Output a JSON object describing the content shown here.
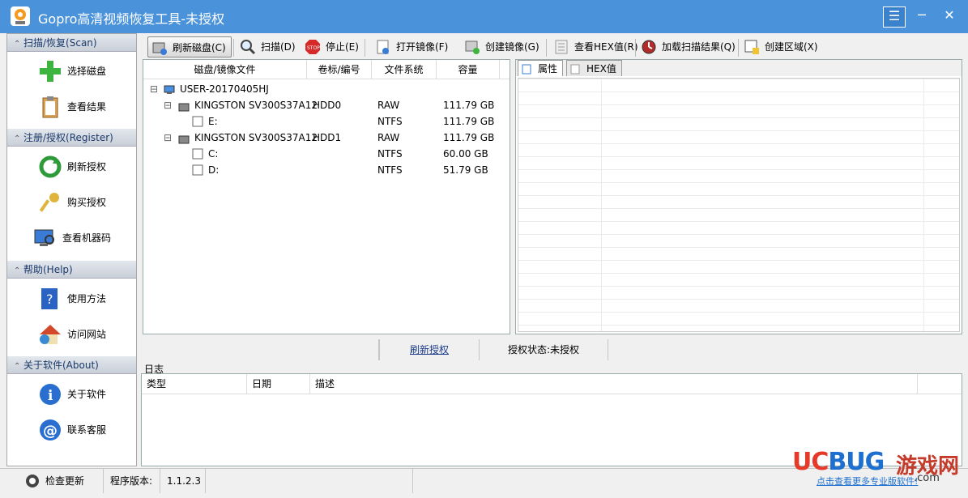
{
  "window": {
    "title": "Gopro高清视频恢复工具-未授权",
    "buttons": {
      "menu": "☰",
      "minimize": "─",
      "close": "✕"
    }
  },
  "sidebar": {
    "sections": [
      {
        "title": "扫描/恢复(Scan)",
        "items": [
          {
            "label": "选择磁盘",
            "icon": "add-plus-icon"
          },
          {
            "label": "查看结果",
            "icon": "clipboard-icon"
          }
        ]
      },
      {
        "title": "注册/授权(Register)",
        "items": [
          {
            "label": "刷新授权",
            "icon": "refresh-icon"
          },
          {
            "label": "购买授权",
            "icon": "key-icon"
          },
          {
            "label": "查看机器码",
            "icon": "computer-search-icon"
          }
        ]
      },
      {
        "title": "帮助(Help)",
        "items": [
          {
            "label": "使用方法",
            "icon": "help-book-icon"
          },
          {
            "label": "访问网站",
            "icon": "home-globe-icon"
          }
        ]
      },
      {
        "title": "关于软件(About)",
        "items": [
          {
            "label": "关于软件",
            "icon": "info-icon"
          },
          {
            "label": "联系客服",
            "icon": "at-mail-icon"
          }
        ]
      }
    ]
  },
  "toolbar": {
    "buttons": [
      {
        "label": "刷新磁盘(C)",
        "icon": "refresh-disk-icon"
      },
      {
        "label": "扫描(D)",
        "icon": "magnifier-icon"
      },
      {
        "label": "停止(E)",
        "icon": "stop-sign-icon"
      },
      {
        "label": "打开镜像(F)",
        "icon": "open-image-icon"
      },
      {
        "label": "创建镜像(G)",
        "icon": "create-image-icon"
      },
      {
        "label": "查看HEX值(R)",
        "icon": "hex-icon"
      },
      {
        "label": "加载扫描结果(Q)",
        "icon": "load-result-icon"
      },
      {
        "label": "创建区域(X)",
        "icon": "create-region-icon"
      }
    ]
  },
  "tree": {
    "columns": [
      "磁盘/镜像文件",
      "卷标/编号",
      "文件系统",
      "容量"
    ],
    "rows": [
      {
        "name": "USER-20170405HJ",
        "label": "",
        "fs": "",
        "size": ""
      },
      {
        "name": "KINGSTON SV300S37A12",
        "label": "HDD0",
        "fs": "RAW",
        "size": "111.79 GB"
      },
      {
        "name": "E:",
        "label": "",
        "fs": "NTFS",
        "size": "111.79 GB"
      },
      {
        "name": "KINGSTON SV300S37A12",
        "label": "HDD1",
        "fs": "RAW",
        "size": "111.79 GB"
      },
      {
        "name": "C:",
        "label": "",
        "fs": "NTFS",
        "size": "60.00 GB"
      },
      {
        "name": "D:",
        "label": "",
        "fs": "NTFS",
        "size": "51.79 GB"
      }
    ]
  },
  "tabs": [
    {
      "label": "属性",
      "icon": "properties-icon"
    },
    {
      "label": "HEX值",
      "icon": "hex-doc-icon"
    }
  ],
  "status": {
    "refresh_link": "刷新授权",
    "auth_status": "授权状态:未授权"
  },
  "log": {
    "label": "日志",
    "columns": [
      "类型",
      "日期",
      "描述"
    ]
  },
  "bottom": {
    "update": "检查更新",
    "version_label": "程序版本:",
    "version": "1.1.2.3"
  },
  "watermark": {
    "u": "UC",
    "b": "BUG",
    "cn": "游戏网",
    "sub": "点击查看更多专业版软件!",
    "com": ".com"
  }
}
